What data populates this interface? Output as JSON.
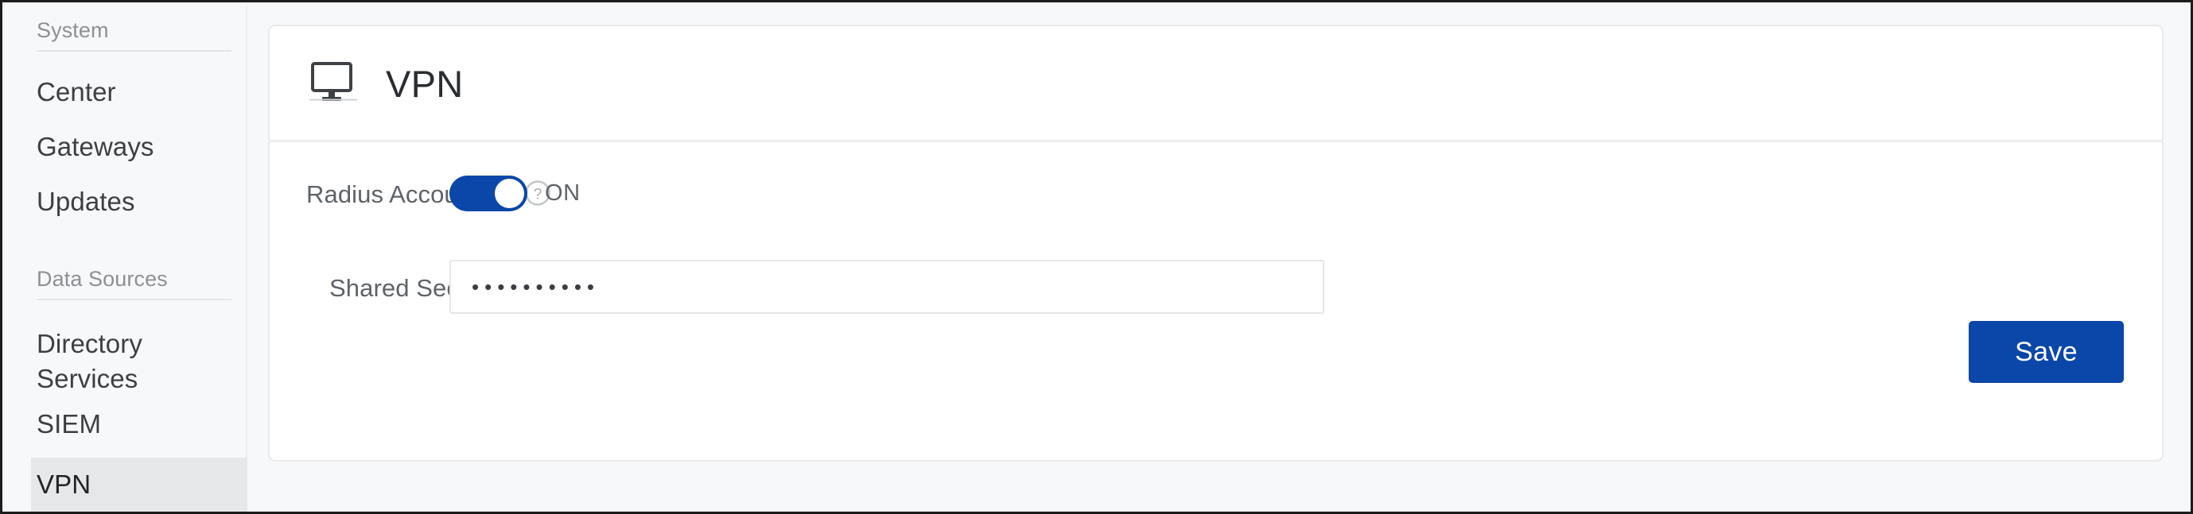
{
  "sidebar": {
    "sections": [
      {
        "title": "System",
        "items": [
          {
            "label": "Center",
            "active": false
          },
          {
            "label": "Gateways",
            "active": false
          },
          {
            "label": "Updates",
            "active": false
          }
        ]
      },
      {
        "title": "Data Sources",
        "items": [
          {
            "label": "Directory Services",
            "active": false
          },
          {
            "label": "SIEM",
            "active": false
          },
          {
            "label": "VPN",
            "active": true
          }
        ]
      }
    ]
  },
  "header": {
    "title": "VPN",
    "icon": "monitor-icon"
  },
  "form": {
    "radius_accounting": {
      "label": "Radius Accounting",
      "help_icon": "help-circle-icon",
      "toggle_state": "ON",
      "toggle_on": true
    },
    "shared_secret": {
      "label": "Shared Secret",
      "value": "••••••••••",
      "placeholder": ""
    }
  },
  "actions": {
    "save_label": "Save"
  },
  "colors": {
    "accent_blue": "#0b47a8",
    "sidebar_bg": "#f7f8fa",
    "active_item_bg": "#e6e7e9",
    "card_border": "#e8eaec",
    "label_text": "#5e6367",
    "muted_text": "#8d9094"
  }
}
